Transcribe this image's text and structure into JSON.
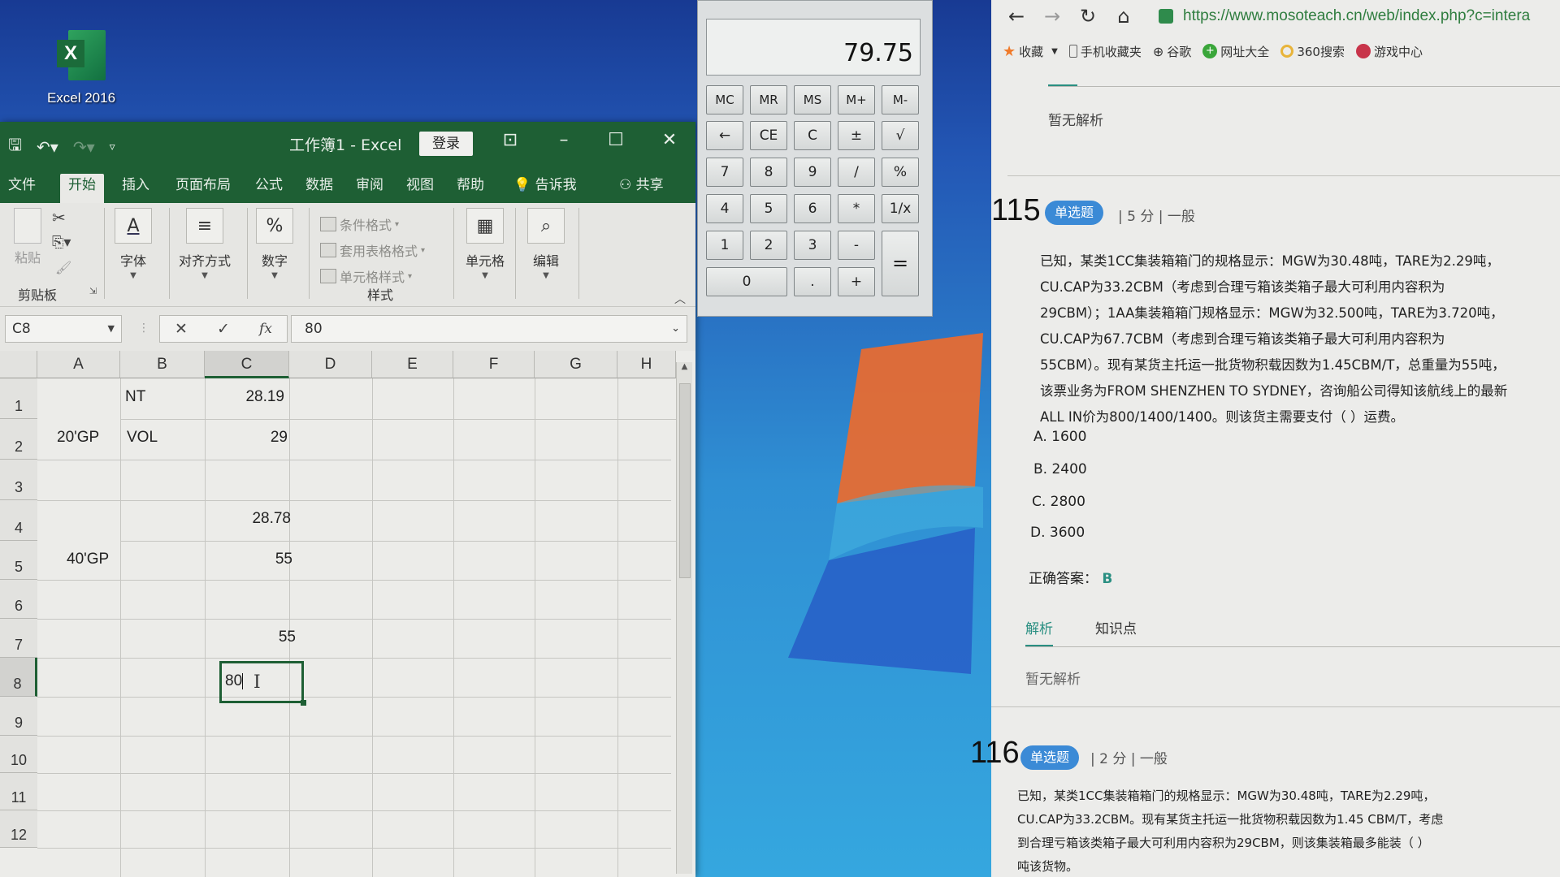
{
  "desktop": {
    "icons": [
      {
        "label": "Excel 2016",
        "icon": "excel-icon"
      }
    ]
  },
  "excel": {
    "title": "工作簿1  -  Excel",
    "login_label": "登录",
    "quick_access": {
      "save": "save-icon",
      "undo": "undo-icon",
      "redo": "redo-icon",
      "customize": "customize-icon"
    },
    "window_controls": {
      "ribbon_display": "ribbon-display-icon",
      "minimize": "minimize-icon",
      "maximize": "maximize-icon",
      "close": "close-icon"
    },
    "tabs": [
      {
        "label": "文件",
        "active": false
      },
      {
        "label": "开始",
        "active": true
      },
      {
        "label": "插入",
        "active": false
      },
      {
        "label": "页面布局",
        "active": false
      },
      {
        "label": "公式",
        "active": false
      },
      {
        "label": "数据",
        "active": false
      },
      {
        "label": "审阅",
        "active": false
      },
      {
        "label": "视图",
        "active": false
      },
      {
        "label": "帮助",
        "active": false
      }
    ],
    "tell_me": "告诉我",
    "share": "共享",
    "ribbon": {
      "clipboard": {
        "paste": "粘贴",
        "group_label": "剪贴板"
      },
      "font": {
        "label": "字体",
        "glyph": "A"
      },
      "alignment": {
        "label": "对齐方式",
        "glyph": "≡"
      },
      "number": {
        "label": "数字",
        "glyph": "%"
      },
      "styles": {
        "conditional_format": "条件格式",
        "table_format": "套用表格格式",
        "cell_styles": "单元格样式",
        "group_label": "样式"
      },
      "cells": {
        "label": "单元格"
      },
      "editing": {
        "label": "编辑"
      }
    },
    "formula_bar": {
      "name_box": "C8",
      "cancel": "✕",
      "enter": "✓",
      "fx": "fx",
      "value": "80"
    },
    "columns": [
      "A",
      "B",
      "C",
      "D",
      "E",
      "F",
      "G",
      "H"
    ],
    "selected_column": "C",
    "rows": [
      "1",
      "2",
      "3",
      "4",
      "5",
      "6",
      "7",
      "8",
      "9",
      "10",
      "11",
      "12"
    ],
    "selected_row": "8",
    "cells": {
      "A1_2": "20'GP",
      "B1": "NT",
      "C1": "28.19",
      "B2": "VOL",
      "C2": "29",
      "A4_5": "40'GP",
      "C4": "28.78",
      "C5": "55",
      "C7": "55",
      "C8_editing": "80"
    }
  },
  "calculator": {
    "display": "79.75",
    "buttons": [
      [
        "MC",
        "MR",
        "MS",
        "M+",
        "M-"
      ],
      [
        "←",
        "CE",
        "C",
        "±",
        "√"
      ],
      [
        "7",
        "8",
        "9",
        "/",
        "%"
      ],
      [
        "4",
        "5",
        "6",
        "*",
        "1/x"
      ],
      [
        "1",
        "2",
        "3",
        "-",
        "="
      ],
      [
        "0",
        ".",
        "+"
      ]
    ]
  },
  "browser": {
    "url": "https://www.mosoteach.cn/web/index.php?c=intera",
    "nav": {
      "back": "←",
      "forward": "→",
      "reload": "↻",
      "home": "⌂"
    },
    "favorites": [
      {
        "label": "收藏",
        "icon": "star-icon",
        "color": "#f07a2a"
      },
      {
        "label": "手机收藏夹",
        "icon": "phone-icon",
        "color": "#777777"
      },
      {
        "label": "谷歌",
        "icon": "globe-icon",
        "color": "#555555"
      },
      {
        "label": "网址大全",
        "icon": "plus-icon",
        "color": "#3aa63a"
      },
      {
        "label": "360搜索",
        "icon": "search-360-icon",
        "color": "#e8b43a"
      },
      {
        "label": "游戏中心",
        "icon": "game-icon",
        "color": "#c8344a"
      }
    ],
    "prev_analysis": "暂无解析",
    "questions": [
      {
        "number": "115",
        "type": "单选题",
        "score": "5 分",
        "difficulty": "一般",
        "body": [
          "已知，某类1CC集装箱箱门的规格显示：MGW为30.48吨，TARE为2.29吨，",
          "CU.CAP为33.2CBM（考虑到合理亏箱该类箱子最大可利用内容积为",
          "29CBM）；1AA集装箱箱门规格显示：MGW为32.500吨，TARE为3.720吨，",
          "CU.CAP为67.7CBM（考虑到合理亏箱该类箱子最大可利用内容积为",
          "55CBM）。现有某货主托运一批货物积载因数为1.45CBM/T，总重量为55吨，",
          "该票业务为FROM SHENZHEN TO SYDNEY，咨询船公司得知该航线上的最新",
          "ALL IN价为800/1400/1400。则该货主需要支付（    ）运费。"
        ],
        "options": [
          "A. 1600",
          "B. 2400",
          "C. 2800",
          "D. 3600"
        ],
        "answer_label": "正确答案：",
        "answer": "B",
        "tabs": [
          {
            "label": "解析",
            "active": true
          },
          {
            "label": "知识点",
            "active": false
          }
        ],
        "analysis": "暂无解析"
      },
      {
        "number": "116",
        "type": "单选题",
        "score": "2 分",
        "difficulty": "一般",
        "body": [
          "已知，某类1CC集装箱箱门的规格显示：MGW为30.48吨，TARE为2.29吨，",
          "CU.CAP为33.2CBM。现有某货主托运一批货物积载因数为1.45 CBM/T，考虑",
          "到合理亏箱该类箱子最大可利用内容积为29CBM，则该集装箱最多能装（    ）",
          "吨该货物。"
        ]
      }
    ]
  }
}
